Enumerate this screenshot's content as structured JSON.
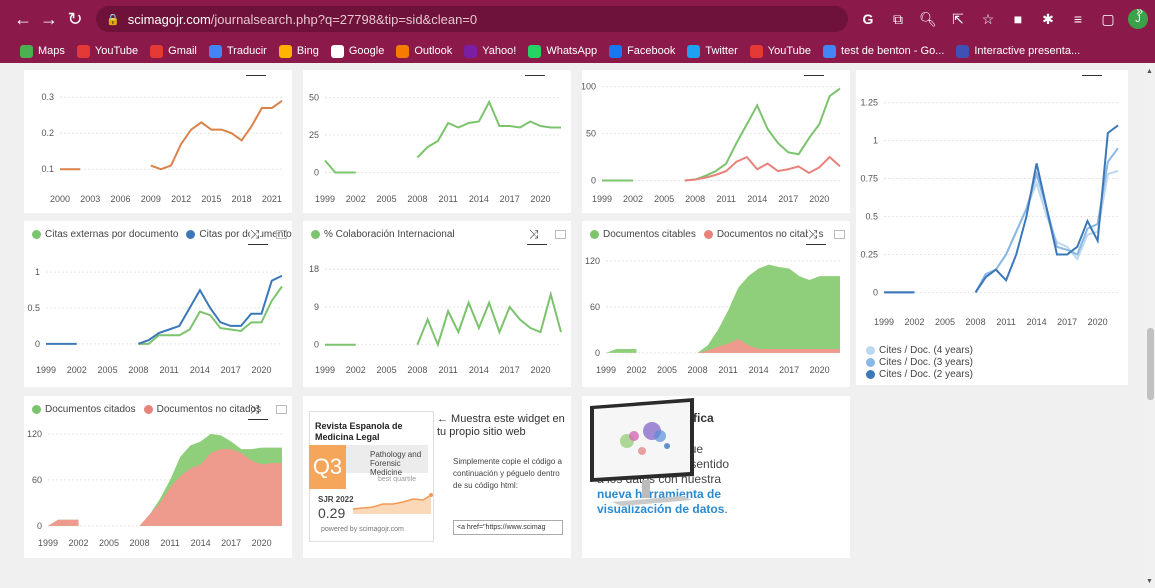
{
  "browser": {
    "url_domain": "scimagojr.com",
    "url_path": "/journalsearch.php?q=27798&tip=sid&clean=0",
    "avatar_letter": "J",
    "bookmarks": [
      {
        "label": "Maps",
        "color": "#4caf50"
      },
      {
        "label": "YouTube",
        "color": "#e53935"
      },
      {
        "label": "Gmail",
        "color": "#e53935"
      },
      {
        "label": "Traducir",
        "color": "#4285f4"
      },
      {
        "label": "Bing",
        "color": "#ffb300"
      },
      {
        "label": "Google",
        "color": "#ffffff"
      },
      {
        "label": "Outlook",
        "color": "#f57c00"
      },
      {
        "label": "Yahoo!",
        "color": "#7b1fa2"
      },
      {
        "label": "WhatsApp",
        "color": "#25d366"
      },
      {
        "label": "Facebook",
        "color": "#1877f2"
      },
      {
        "label": "Twitter",
        "color": "#1da1f2"
      },
      {
        "label": "YouTube",
        "color": "#e53935"
      },
      {
        "label": "test de benton - Go...",
        "color": "#4285f4"
      },
      {
        "label": "Interactive presenta...",
        "color": "#3f51b5"
      }
    ]
  },
  "chart_data": [
    {
      "id": "c1",
      "type": "line",
      "x": [
        2000,
        2001,
        2002,
        2003,
        2004,
        2005,
        2006,
        2007,
        2008,
        2009,
        2010,
        2011,
        2012,
        2013,
        2014,
        2015,
        2016,
        2017,
        2018,
        2019,
        2020,
        2021,
        2022
      ],
      "series": [
        {
          "color": "#d9824b",
          "values": [
            0.1,
            0.1,
            0.1,
            null,
            null,
            null,
            null,
            null,
            null,
            0.11,
            0.1,
            0.11,
            0.17,
            0.21,
            0.23,
            0.21,
            0.21,
            0.2,
            0.18,
            0.22,
            0.27,
            0.27,
            0.29
          ]
        }
      ],
      "ylim": [
        0.07,
        0.32
      ],
      "yticks": [
        "0.1",
        "0.2",
        "0.3"
      ],
      "xticks": [
        "2000",
        "2003",
        "2006",
        "2009",
        "2012",
        "2015",
        "2018",
        "2021"
      ]
    },
    {
      "id": "c2",
      "type": "line",
      "x": [
        1999,
        2000,
        2001,
        2002,
        2003,
        2004,
        2005,
        2006,
        2007,
        2008,
        2009,
        2010,
        2011,
        2012,
        2013,
        2014,
        2015,
        2016,
        2017,
        2018,
        2019,
        2020,
        2021,
        2022
      ],
      "series": [
        {
          "color": "#7cc36d",
          "values": [
            8,
            0,
            0,
            0,
            null,
            null,
            null,
            null,
            null,
            10,
            17,
            21,
            33,
            30,
            33,
            34,
            47,
            31,
            31,
            30,
            34,
            31,
            30,
            30
          ]
        }
      ],
      "ylim": [
        -5,
        55
      ],
      "yticks": [
        "0",
        "25",
        "50"
      ],
      "xticks": [
        "1999",
        "2002",
        "2005",
        "2008",
        "2011",
        "2014",
        "2017",
        "2020"
      ]
    },
    {
      "id": "c3",
      "type": "line",
      "x": [
        1999,
        2000,
        2001,
        2002,
        2003,
        2004,
        2005,
        2006,
        2007,
        2008,
        2009,
        2010,
        2011,
        2012,
        2013,
        2014,
        2015,
        2016,
        2017,
        2018,
        2019,
        2020,
        2021,
        2022
      ],
      "series": [
        {
          "color": "#7cc36d",
          "values": [
            0,
            0,
            0,
            0,
            null,
            null,
            null,
            null,
            0,
            1,
            5,
            10,
            18,
            40,
            60,
            80,
            55,
            40,
            30,
            28,
            45,
            60,
            90,
            98
          ]
        },
        {
          "color": "#e8827a",
          "values": [
            null,
            null,
            null,
            null,
            null,
            null,
            null,
            null,
            0,
            1,
            3,
            6,
            10,
            20,
            25,
            12,
            18,
            10,
            12,
            15,
            8,
            14,
            25,
            15
          ]
        }
      ],
      "ylim": [
        -8,
        105
      ],
      "yticks": [
        "0",
        "50",
        "100"
      ],
      "xticks": [
        "1999",
        "2002",
        "2005",
        "2008",
        "2011",
        "2014",
        "2017",
        "2020"
      ]
    },
    {
      "id": "c4",
      "type": "line",
      "x": [
        1999,
        2000,
        2001,
        2002,
        2003,
        2004,
        2005,
        2006,
        2007,
        2008,
        2009,
        2010,
        2011,
        2012,
        2013,
        2014,
        2015,
        2016,
        2017,
        2018,
        2019,
        2020,
        2021,
        2022
      ],
      "legend": [
        "Cites / Doc. (4 years)",
        "Cites / Doc. (3 years)",
        "Cites / Doc. (2 years)"
      ],
      "series": [
        {
          "name": "Cites / Doc. (4 years)",
          "color": "#bcd7f0",
          "values": [
            0,
            0,
            0,
            0,
            null,
            null,
            null,
            null,
            null,
            0,
            0.12,
            0.15,
            0.25,
            0.4,
            0.55,
            0.72,
            0.5,
            0.33,
            0.3,
            0.22,
            0.38,
            0.4,
            0.78,
            0.8
          ]
        },
        {
          "name": "Cites / Doc. (3 years)",
          "color": "#8ab7e3",
          "values": [
            0,
            0,
            0,
            0,
            null,
            null,
            null,
            null,
            null,
            0,
            0.12,
            0.15,
            0.25,
            0.4,
            0.55,
            0.78,
            0.55,
            0.3,
            0.28,
            0.25,
            0.42,
            0.45,
            0.86,
            0.95
          ]
        },
        {
          "name": "Cites / Doc. (2 years)",
          "color": "#3c78b8",
          "values": [
            0,
            0,
            0,
            0,
            null,
            null,
            null,
            null,
            null,
            0,
            0.1,
            0.15,
            0.08,
            0.25,
            0.5,
            0.85,
            0.55,
            0.25,
            0.25,
            0.3,
            0.47,
            0.34,
            1.05,
            1.1
          ]
        }
      ],
      "ylim": [
        -0.05,
        1.32
      ],
      "yticks": [
        "0",
        "0.25",
        "0.5",
        "0.75",
        "1",
        "1.25"
      ],
      "xticks": [
        "1999",
        "2002",
        "2005",
        "2008",
        "2011",
        "2014",
        "2017",
        "2020"
      ]
    },
    {
      "id": "c5",
      "type": "line",
      "x": [
        1999,
        2000,
        2001,
        2002,
        2003,
        2004,
        2005,
        2006,
        2007,
        2008,
        2009,
        2010,
        2011,
        2012,
        2013,
        2014,
        2015,
        2016,
        2017,
        2018,
        2019,
        2020,
        2021,
        2022
      ],
      "legend": [
        "Citas externas por documento",
        "Citas por documento"
      ],
      "series": [
        {
          "name": "Citas externas por documento",
          "color": "#7cc36d",
          "values": [
            null,
            null,
            null,
            null,
            null,
            null,
            null,
            null,
            null,
            0,
            0,
            0.12,
            0.12,
            0.12,
            0.2,
            0.45,
            0.4,
            0.22,
            0.2,
            0.18,
            0.3,
            0.3,
            0.6,
            0.8
          ]
        },
        {
          "name": "Citas por documento",
          "color": "#3c78b8",
          "values": [
            0,
            0,
            0,
            0,
            null,
            null,
            null,
            null,
            null,
            0,
            0.05,
            0.15,
            0.2,
            0.25,
            0.5,
            0.75,
            0.5,
            0.3,
            0.25,
            0.25,
            0.42,
            0.42,
            0.88,
            0.95
          ]
        }
      ],
      "ylim": [
        -0.1,
        1.1
      ],
      "yticks": [
        "0",
        "0.5",
        "1"
      ],
      "xticks": [
        "1999",
        "2002",
        "2005",
        "2008",
        "2011",
        "2014",
        "2017",
        "2020"
      ]
    },
    {
      "id": "c6",
      "type": "line",
      "x": [
        1999,
        2000,
        2001,
        2002,
        2003,
        2004,
        2005,
        2006,
        2007,
        2008,
        2009,
        2010,
        2011,
        2012,
        2013,
        2014,
        2015,
        2016,
        2017,
        2018,
        2019,
        2020,
        2021,
        2022
      ],
      "legend": [
        "% Colaboración Internacional"
      ],
      "series": [
        {
          "name": "% Colaboración Internacional",
          "color": "#7cc36d",
          "values": [
            0,
            0,
            0,
            0,
            null,
            null,
            null,
            null,
            null,
            0,
            6,
            0,
            8,
            3,
            10,
            4,
            10,
            3,
            9,
            6,
            4,
            3,
            12,
            3,
            16
          ]
        }
      ],
      "ylim": [
        -1.5,
        19
      ],
      "yticks": [
        "0",
        "9",
        "18"
      ],
      "xticks": [
        "1999",
        "2002",
        "2005",
        "2008",
        "2011",
        "2014",
        "2017",
        "2020"
      ]
    },
    {
      "id": "c7",
      "type": "area",
      "x": [
        1999,
        2000,
        2001,
        2002,
        2003,
        2004,
        2005,
        2006,
        2007,
        2008,
        2009,
        2010,
        2011,
        2012,
        2013,
        2014,
        2015,
        2016,
        2017,
        2018,
        2019,
        2020,
        2021,
        2022
      ],
      "legend": [
        "Documentos citables",
        "Documentos no citables"
      ],
      "series": [
        {
          "name": "Documentos citables",
          "color": "#8fcf7b",
          "values": [
            0,
            5,
            5,
            5,
            null,
            null,
            null,
            null,
            null,
            0,
            10,
            30,
            55,
            85,
            100,
            110,
            115,
            112,
            110,
            100,
            95,
            100,
            100,
            100
          ]
        },
        {
          "name": "Documentos no citables",
          "color": "#ee9a8c",
          "values": [
            0,
            0,
            0,
            0,
            null,
            null,
            null,
            null,
            null,
            0,
            3,
            8,
            12,
            18,
            10,
            5,
            5,
            5,
            5,
            5,
            5,
            5,
            5,
            5
          ]
        }
      ],
      "ylim": [
        -8,
        125
      ],
      "yticks": [
        "0",
        "60",
        "120"
      ],
      "xticks": [
        "1999",
        "2002",
        "2005",
        "2008",
        "2011",
        "2014",
        "2017",
        "2020"
      ]
    },
    {
      "id": "c8",
      "type": "area",
      "x": [
        1999,
        2000,
        2001,
        2002,
        2003,
        2004,
        2005,
        2006,
        2007,
        2008,
        2009,
        2010,
        2011,
        2012,
        2013,
        2014,
        2015,
        2016,
        2017,
        2018,
        2019,
        2020,
        2021,
        2022
      ],
      "legend": [
        "Documentos citados",
        "Documentos no citados"
      ],
      "series": [
        {
          "name": "Documentos citados",
          "color": "#8fcf7b",
          "values": [
            0,
            8,
            8,
            8,
            null,
            null,
            null,
            null,
            null,
            0,
            15,
            35,
            60,
            90,
            105,
            110,
            120,
            118,
            110,
            100,
            100,
            102,
            102,
            102
          ]
        },
        {
          "name": "Documentos no citados",
          "color": "#ee9a8c",
          "values": [
            0,
            8,
            8,
            8,
            null,
            null,
            null,
            null,
            null,
            0,
            15,
            30,
            50,
            65,
            75,
            80,
            95,
            100,
            100,
            95,
            85,
            80,
            82,
            82
          ]
        }
      ],
      "ylim": [
        -8,
        125
      ],
      "yticks": [
        "0",
        "60",
        "120"
      ],
      "xticks": [
        "1999",
        "2002",
        "2005",
        "2008",
        "2011",
        "2014",
        "2017",
        "2020"
      ]
    }
  ],
  "widget": {
    "journal_name": "Revista Espanola de Medicina Legal",
    "quartile": "Q3",
    "category": "Pathology and Forensic Medicine",
    "quartile_label": "best quartile",
    "sjr_label": "SJR 2022",
    "sjr_value": "0.29",
    "powered": "powered by scimagojr.com",
    "arrow_text": "← Muestra este widget en tu propio sitio web",
    "desc": "Simplemente copie el código a continuación y péguelo dentro de su código html:",
    "code": "<a href=\"https://www.scimag"
  },
  "grafica": {
    "title": "SCImago Gráfica",
    "text": "Explore, comunique visualmente y dé sentido a los datos con nuestra",
    "link": "nueva herramienta de visualización de datos",
    "end": "."
  }
}
